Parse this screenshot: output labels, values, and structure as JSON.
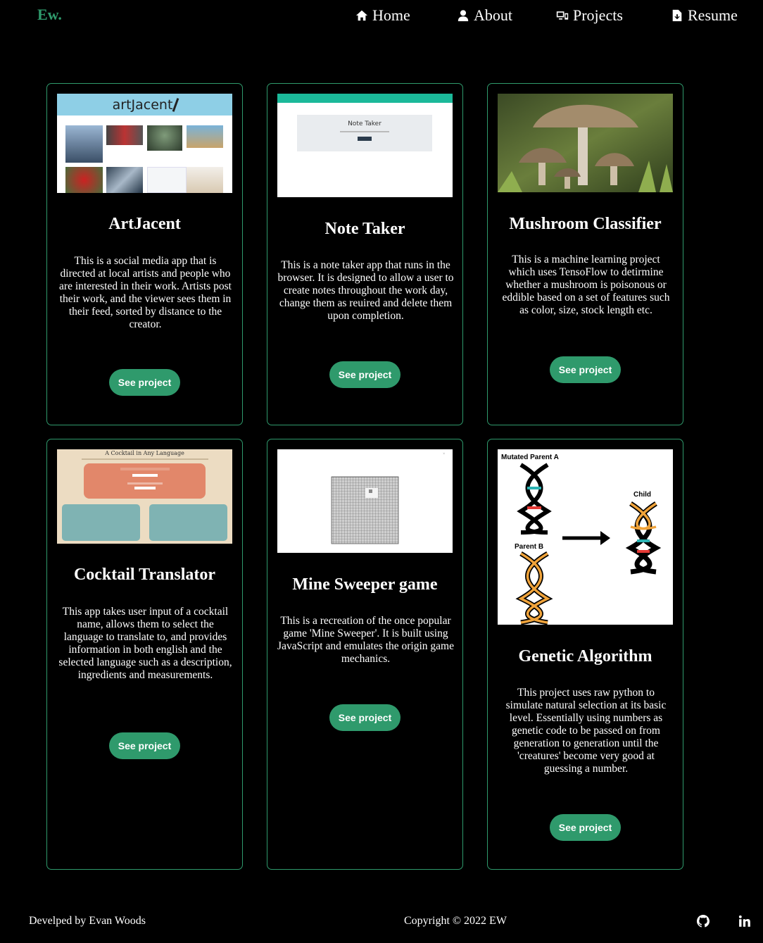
{
  "brand": {
    "logo": "Ew.",
    "accent": "#2f9a6c"
  },
  "nav": {
    "home": {
      "label": "Home",
      "icon": "home-icon"
    },
    "about": {
      "label": "About",
      "icon": "user-icon"
    },
    "projects": {
      "label": "Projects",
      "icon": "devices-icon"
    },
    "resume": {
      "label": "Resume",
      "icon": "file-download-icon"
    }
  },
  "projects": [
    {
      "title": "ArtJacent",
      "description": "This is a social media app that is directed at local artists and people who are interested in their work. Artists post their work, and the viewer sees them in their feed, sorted by distance to the creator.",
      "button": "See project",
      "thumb_brand": "artJacent"
    },
    {
      "title": "Note Taker",
      "description": "This is a note taker app that runs in the browser. It is designed to allow a user to create notes throughout the work day, change them as reuired and delete them upon completion.",
      "button": "See project",
      "thumb_heading": "Note Taker"
    },
    {
      "title": "Mushroom Classifier",
      "description": "This is a machine learning project which uses TensoFlow to detirmine whether a mushroom is poisonous or eddible based on a set of features such as color, size, stock length etc.",
      "button": "See project"
    },
    {
      "title": "Cocktail Translator",
      "description": "This app takes user input of a cocktail name, allows them to select the language to translate to, and provides information in both english and the selected language such as a description, ingredients and measurements.",
      "button": "See project",
      "thumb_heading": "A Cocktail in Any Language"
    },
    {
      "title": "Mine Sweeper game",
      "description": "This is a recreation of the once popular game 'Mine Sweeper'. It is built using JavaScript and emulates the origin game mechanics.",
      "button": "See project"
    },
    {
      "title": "Genetic Algorithm",
      "description": "This project uses raw python to simulate natural selection at its basic level. Essentially using numbers as genetic code to be passed on from generation to generation until the 'creatures' become very good at guessing a number.",
      "button": "See project",
      "thumb_labels": {
        "parent_a": "Mutated Parent A",
        "parent_b": "Parent B",
        "child": "Child"
      }
    }
  ],
  "footer": {
    "left": "Develped by Evan Woods",
    "center": "Copyright © 2022 EW",
    "icons": [
      "github-icon",
      "linkedin-icon"
    ]
  }
}
